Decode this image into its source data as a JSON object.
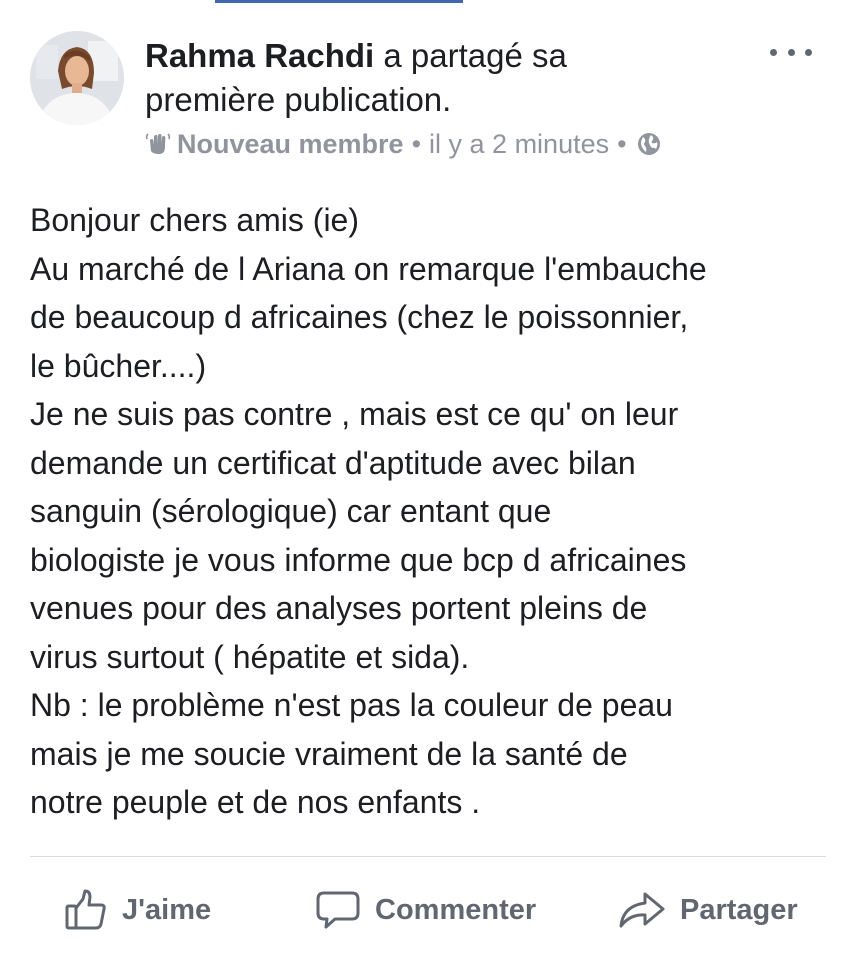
{
  "post": {
    "author": "Rahma Rachdi",
    "action_text": " a partagé sa première publication.",
    "badge": "Nouveau membre",
    "separator": "•",
    "time": "il y a 2 minutes",
    "lines": [
      "Bonjour chers amis  (ie)",
      "Au marché de l Ariana on remarque l'embauche",
      "de beaucoup d africaines  (chez le poissonnier,",
      "le bûcher....)",
      "Je ne suis pas contre , mais est ce qu' on leur",
      "demande un certificat d'aptitude avec bilan",
      "sanguin  (sérologique) car entant que",
      "biologiste je vous informe que bcp d africaines",
      "venues pour des analyses portent pleins de",
      "virus surtout ( hépatite et sida).",
      "Nb : le problème n'est pas la  couleur de peau",
      "mais je me soucie vraiment de la santé de",
      "notre peuple et de nos enfants ."
    ]
  },
  "actions": {
    "like_label": "J'aime",
    "comment_label": "Commenter",
    "share_label": "Partager"
  },
  "icons": {
    "more": "more-options-icon",
    "badge": "wave-hand-icon",
    "privacy": "globe-icon",
    "like": "thumbs-up-icon",
    "comment": "comment-bubble-icon",
    "share": "share-arrow-icon"
  },
  "colors": {
    "accent": "#4267b2",
    "text": "#1c1e21",
    "meta": "#90949c",
    "action": "#606770"
  }
}
